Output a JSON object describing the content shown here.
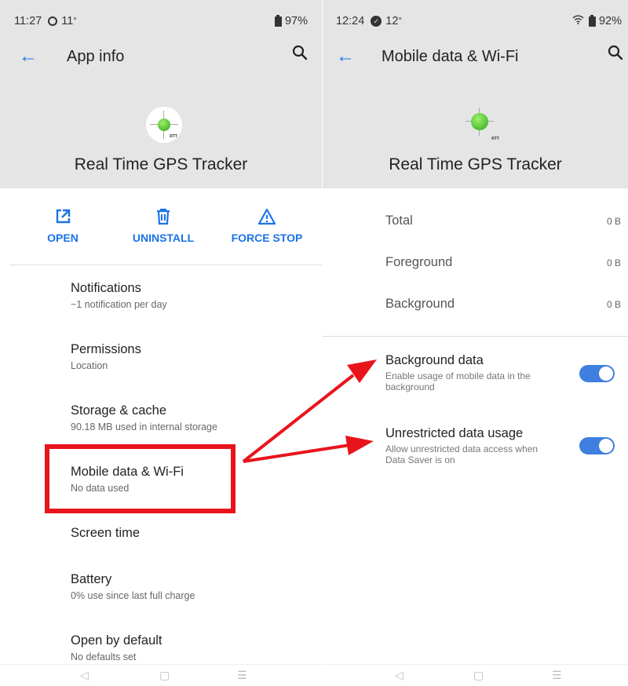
{
  "left_screen": {
    "status": {
      "time": "11:27",
      "temp": "11",
      "battery": "97%"
    },
    "title": "App info",
    "app_name": "Real Time GPS Tracker",
    "app_icon_label": "RTT",
    "actions": [
      {
        "label": "OPEN",
        "icon": "open-external-icon"
      },
      {
        "label": "UNINSTALL",
        "icon": "trash-icon"
      },
      {
        "label": "FORCE STOP",
        "icon": "warning-icon"
      }
    ],
    "items": [
      {
        "title": "Notifications",
        "subtitle": "~1 notification per day"
      },
      {
        "title": "Permissions",
        "subtitle": "Location"
      },
      {
        "title": "Storage & cache",
        "subtitle": "90.18 MB used in internal storage"
      },
      {
        "title": "Mobile data & Wi-Fi",
        "subtitle": "No data used"
      },
      {
        "title": "Screen time",
        "subtitle": ""
      },
      {
        "title": "Battery",
        "subtitle": "0% use since last full charge"
      },
      {
        "title": "Open by default",
        "subtitle": "No defaults set"
      }
    ]
  },
  "right_screen": {
    "status": {
      "time": "12:24",
      "temp": "12",
      "battery": "92%"
    },
    "title": "Mobile data & Wi-Fi",
    "app_name": "Real Time GPS Tracker",
    "app_icon_label": "RTT",
    "usage": [
      {
        "label": "Total",
        "value": "0 B"
      },
      {
        "label": "Foreground",
        "value": "0 B"
      },
      {
        "label": "Background",
        "value": "0 B"
      }
    ],
    "toggles": [
      {
        "title": "Background data",
        "subtitle": "Enable usage of mobile data in the background",
        "on": true
      },
      {
        "title": "Unrestricted data usage",
        "subtitle": "Allow unrestricted data access when Data Saver is on",
        "on": true
      }
    ]
  },
  "colors": {
    "accent": "#1a73e8",
    "annotation": "#e8141c",
    "toggle_on": "#3f7fe0",
    "header_bg": "#e5e5e5"
  }
}
